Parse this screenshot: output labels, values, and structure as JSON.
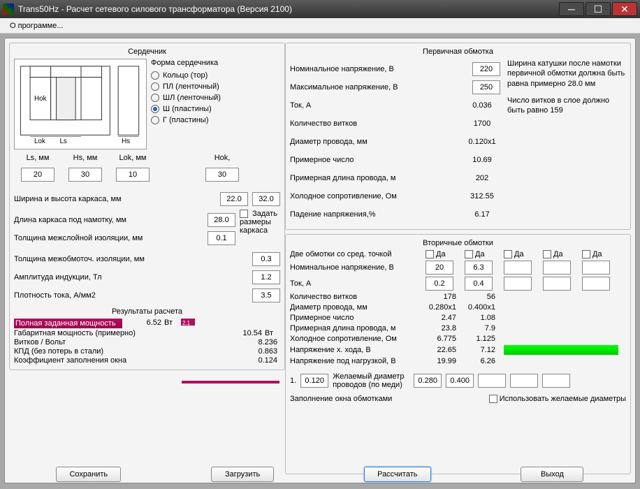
{
  "window": {
    "title": "Trans50Hz - Расчет сетевого силового трансформатора (Версия 2100)"
  },
  "menu": {
    "about": "О программе..."
  },
  "core": {
    "title": "Сердечник",
    "formTitle": "Форма сердечника",
    "options": {
      "ring": "Кольцо (тор)",
      "pl": "ПЛ (ленточный)",
      "shl": "ШЛ (ленточный)",
      "sh": "Ш (пластины)",
      "g": "Г (пластины)"
    },
    "dims": {
      "ls": {
        "label": "Ls, мм",
        "value": "20"
      },
      "hs": {
        "label": "Hs, мм",
        "value": "30"
      },
      "lok": {
        "label": "Lok, мм",
        "value": "10"
      },
      "hok": {
        "label": "Hok,",
        "value": "30"
      }
    },
    "diagLabels": {
      "hok": "Hok",
      "lok": "Lok",
      "ls": "Ls",
      "hs": "Hs"
    },
    "frame": {
      "wh": {
        "label": "Ширина и высота каркаса, мм",
        "w": "22.0",
        "h": "32.0"
      },
      "len": {
        "label": "Длина каркаса под намотку, мм",
        "value": "28.0"
      },
      "interlayer": {
        "label": "Толщина межслойной изоляции, мм",
        "value": "0.1"
      },
      "interwind": {
        "label": "Толщина межобмоточ. изоляции, мм",
        "value": "0.3"
      },
      "induction": {
        "label": "Амплитуда индукции, Тл",
        "value": "1.2"
      },
      "currDensity": {
        "label": "Плотность тока, А/мм2",
        "value": "3.5"
      },
      "setFrame": "Задать размеры каркаса"
    }
  },
  "results": {
    "title": "Результаты расчета",
    "rows": {
      "power": {
        "label": "Полная заданная мощность",
        "value": "6.52",
        "unit": "Вт",
        "bar": "2.1"
      },
      "gabPower": {
        "label": "Габаритная мощность (примерно)",
        "value": "10.54",
        "unit": "Вт"
      },
      "turnsPerVolt": {
        "label": "Витков / Вольт",
        "value": "8.236"
      },
      "kpd": {
        "label": "КПД (без потерь в стали)",
        "value": "0.863"
      },
      "fill": {
        "label": "Коэффициент заполнения окна",
        "value": "0.124"
      }
    }
  },
  "primary": {
    "title": "Первичная обмотка",
    "nominalV": {
      "label": "Номинальное напряжение, В",
      "value": "220"
    },
    "maxV": {
      "label": "Максимальное напряжение, В",
      "value": "250"
    },
    "rows": {
      "current": {
        "label": "Ток, А",
        "value": "0.036"
      },
      "turns": {
        "label": "Количество витков",
        "value": "1700"
      },
      "wireDia": {
        "label": "Диаметр провода, мм",
        "value": "0.120x1"
      },
      "approxNum": {
        "label": "Примерное число",
        "value": "10.69"
      },
      "wireLen": {
        "label": "Примерная длина провода, м",
        "value": "202"
      },
      "coldRes": {
        "label": "Холодное сопротивление, Ом",
        "value": "312.55"
      },
      "voltDrop": {
        "label": "Падение напряжения,%",
        "value": "6.17"
      }
    },
    "note1": "Ширина катушки после намотки первичной обмотки должна быть равна примерно 28.0 мм",
    "note2": "Число витков в слое должно быть равно 159"
  },
  "secondary": {
    "title": "Вторичные обмотки",
    "centerTap": "Две обмотки со сред. точкой",
    "da": "Да",
    "nominalV": "Номинальное напряжение, В",
    "current": "Ток, А",
    "turns": "Количество витков",
    "wireDia": "Диаметр провода, мм",
    "approxNum": "Примерное число",
    "wireLen": "Примерная длина провода, м",
    "coldRes": "Холодное сопротивление, Ом",
    "openV": "Напряжение х. хода, В",
    "loadV": "Напряжение под нагрузкой, В",
    "desiredDia": "Желаемый диаметр проводов (по меди)",
    "fillWin": "Заполнение окна обмотками",
    "useDesired": "Использовать желаемые диаметры",
    "cols": {
      "c1": {
        "v": "20",
        "i": "0.2",
        "turns": "178",
        "dia": "0.280x1",
        "num": "2.47",
        "len": "23.8",
        "res": "6.775",
        "openv": "22.65",
        "loadv": "19.99",
        "desd": "0.280"
      },
      "c2": {
        "v": "6.3",
        "i": "0.4",
        "turns": "56",
        "dia": "0.400x1",
        "num": "1.08",
        "len": "7.9",
        "res": "1.125",
        "openv": "7.12",
        "loadv": "6.26",
        "desd": "0.400"
      }
    },
    "desd0": "0.120"
  },
  "buttons": {
    "save": "Сохранить",
    "load": "Загрузить",
    "calc": "Рассчитать",
    "exit": "Выход"
  }
}
